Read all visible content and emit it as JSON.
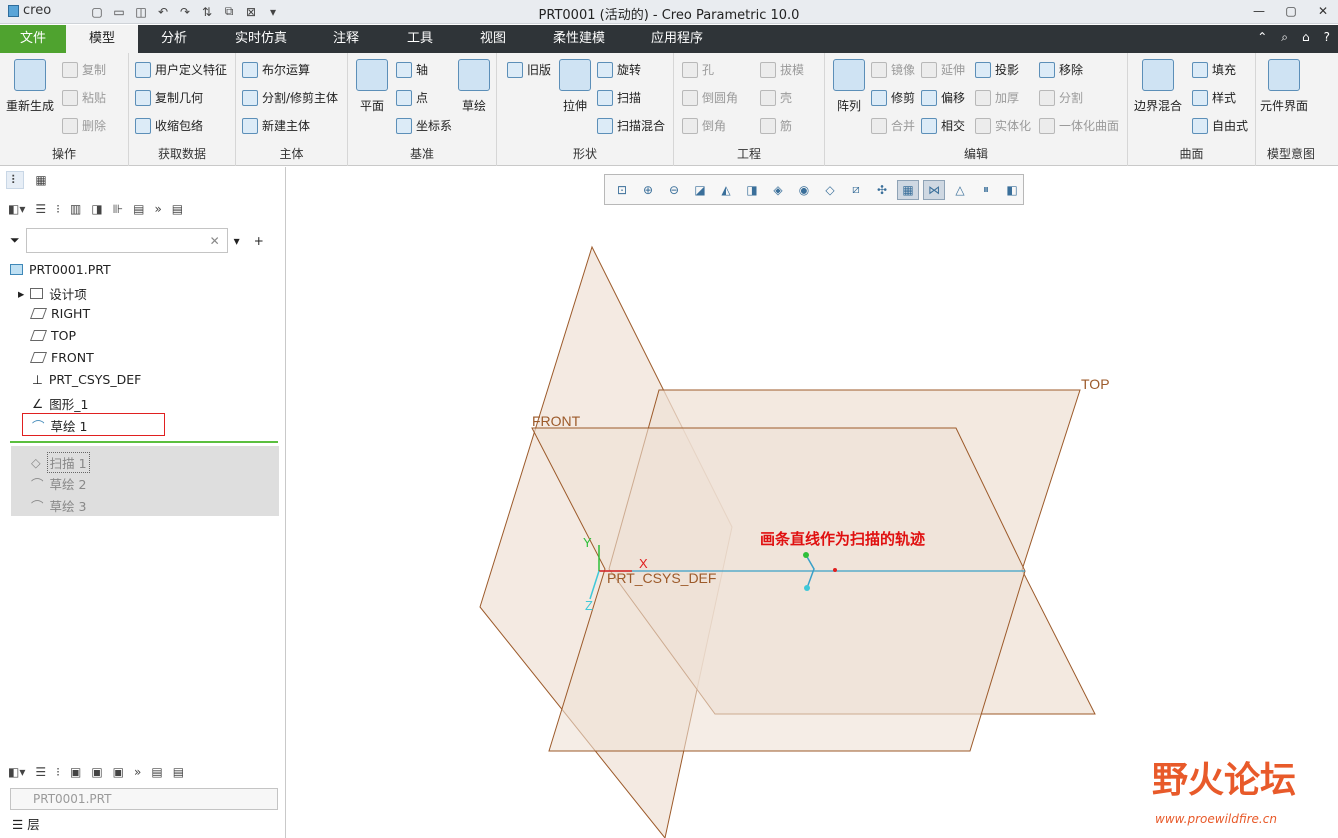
{
  "app": {
    "logo": "creo",
    "title": "PRT0001 (活动的) - Creo Parametric 10.0"
  },
  "tabs": [
    "文件",
    "模型",
    "分析",
    "实时仿真",
    "注释",
    "工具",
    "视图",
    "柔性建模",
    "应用程序"
  ],
  "ribbon": {
    "operations": {
      "regen": "重新生成",
      "copy": "复制",
      "paste": "粘贴",
      "delete": "删除",
      "label": "操作"
    },
    "getdata": {
      "udf": "用户定义特征",
      "copygeom": "复制几何",
      "shrinkwrap": "收缩包络",
      "label": "获取数据"
    },
    "body": {
      "boolean": "布尔运算",
      "split": "分割/修剪主体",
      "newbody": "新建主体",
      "label": "主体"
    },
    "datum": {
      "plane": "平面",
      "axis": "轴",
      "point": "点",
      "csys": "坐标系",
      "sketch": "草绘",
      "label": "基准"
    },
    "shapes": {
      "legacy": "旧版",
      "extrude": "拉伸",
      "revolve": "旋转",
      "sweep": "扫描",
      "sweepblend": "扫描混合",
      "label": "形状"
    },
    "engineering": {
      "hole": "孔",
      "round": "倒圆角",
      "chamfer": "倒角",
      "draft": "拔模",
      "shell": "壳",
      "rib": "筋",
      "label": "工程"
    },
    "editing": {
      "pattern": "阵列",
      "mirror": "镜像",
      "trim": "修剪",
      "merge": "合并",
      "extend": "延伸",
      "offset": "偏移",
      "intersect": "相交",
      "project": "投影",
      "thicken": "加厚",
      "solidify": "实体化",
      "remove": "移除",
      "split": "分割",
      "unify": "一体化曲面",
      "label": "编辑"
    },
    "surfaces": {
      "boundary": "边界混合",
      "fill": "填充",
      "style": "样式",
      "freestyle": "自由式",
      "label": "曲面"
    },
    "intent": {
      "component": "元件界面",
      "label": "模型意图"
    }
  },
  "tree": {
    "root": "PRT0001.PRT",
    "items": [
      "设计项",
      "RIGHT",
      "TOP",
      "FRONT",
      "PRT_CSYS_DEF",
      "图形_1",
      "草绘 1"
    ],
    "after": [
      "扫描 1",
      "草绘 2",
      "草绘 3"
    ]
  },
  "layers": {
    "select": "PRT0001.PRT",
    "label": "层"
  },
  "viewport": {
    "plane_top": "TOP",
    "plane_front": "FRONT",
    "csys": "PRT_CSYS_DEF",
    "axis_x": "X",
    "axis_y": "Y",
    "axis_z": "Z",
    "annotation": "画条直线作为扫描的轨迹"
  },
  "watermark": {
    "text": "野火论坛",
    "url": "www.proewildfire.cn"
  },
  "colors": {
    "file_tab": "#4fa32f",
    "plane_fill": "#f0e3d8",
    "plane_edge": "#9c5a2a",
    "annotation": "#e01010",
    "highlight_box": "#e02020"
  }
}
